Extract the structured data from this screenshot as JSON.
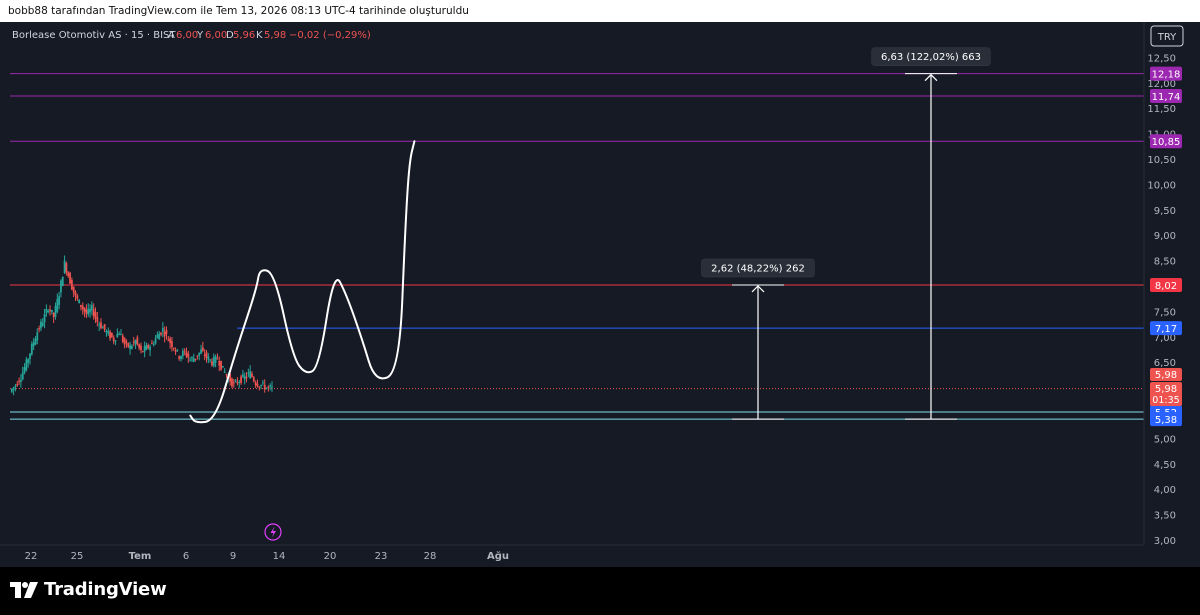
{
  "header": {
    "caption": "bobb88 tarafından TradingView.com ile Tem 13, 2026 08:13 UTC-4 tarihinde oluşturuldu"
  },
  "symbol": {
    "name": "Borlease Otomotiv AS · 15 · BIST",
    "o_label": "A",
    "o_value": "6,00",
    "h_label": "Y",
    "h_value": "6,00",
    "l_label": "D",
    "l_value": "5,96",
    "c_label": "K",
    "c_value": "5,98",
    "change": "−0,02 (−0,29%)"
  },
  "currency_badge": "TRY",
  "footer": {
    "brand": "TradingView"
  },
  "colors": {
    "bg": "#161a25",
    "up": "#26a69a",
    "down": "#ef5350",
    "purple": "#9c27b0",
    "red_line": "#f23645",
    "blue_line": "#2962ff",
    "cyan_line": "#80deea",
    "text": "#d1d4dc"
  },
  "chart_data": {
    "type": "line",
    "price_scale": {
      "ylim": [
        3.0,
        12.5
      ],
      "ticks": [
        "3,00",
        "3,50",
        "4,00",
        "4,50",
        "5,00",
        "5,50",
        "6,00",
        "6,50",
        "7,00",
        "7,50",
        "8,00",
        "8,50",
        "9,00",
        "9,50",
        "10,00",
        "10,50",
        "11,00",
        "11,50",
        "12,00",
        "12,50"
      ]
    },
    "time_scale": {
      "ticks": [
        "22",
        "25",
        "Tem",
        "6",
        "9",
        "14",
        "20",
        "23",
        "28",
        "Ağu"
      ]
    },
    "horizontal_lines": [
      {
        "price": 12.18,
        "label": "12,18",
        "color": "#9c27b0"
      },
      {
        "price": 11.74,
        "label": "11,74",
        "color": "#9c27b0"
      },
      {
        "price": 10.85,
        "label": "10,85",
        "color": "#9c27b0"
      },
      {
        "price": 8.02,
        "label": "8,02",
        "color": "#f23645"
      },
      {
        "price": 7.17,
        "label": "7,17",
        "color": "#2962ff"
      },
      {
        "price": 5.52,
        "label": "5,52",
        "color": "#2962ff"
      },
      {
        "price": 5.38,
        "label": "5,38",
        "color": "#2962ff"
      }
    ],
    "current_price": {
      "price": 5.98,
      "label": "5,98",
      "countdown": "01:35",
      "bar_label": "5,98"
    },
    "measures": [
      {
        "from": 5.38,
        "to": 8.02,
        "label": "2,62 (48,22%) 262"
      },
      {
        "from": 5.38,
        "to": 12.18,
        "label": "6,63 (122,02%) 663"
      }
    ],
    "price_series": [
      5.92,
      6.05,
      6.22,
      6.48,
      6.8,
      7.1,
      7.32,
      7.58,
      7.4,
      7.85,
      8.45,
      8.1,
      7.78,
      7.62,
      7.45,
      7.55,
      7.3,
      7.18,
      7.05,
      6.95,
      7.1,
      6.85,
      6.8,
      6.92,
      6.7,
      6.78,
      6.85,
      7.02,
      7.15,
      6.95,
      6.8,
      6.62,
      6.7,
      6.55,
      6.6,
      6.72,
      6.6,
      6.5,
      6.58,
      6.35,
      6.2,
      6.05,
      6.15,
      6.2,
      6.28,
      6.1,
      6.05,
      6.0,
      5.98
    ],
    "projection_path": [
      [
        16.0,
        5.45
      ],
      [
        16.5,
        5.3
      ],
      [
        18.5,
        5.35
      ],
      [
        20.5,
        6.7
      ],
      [
        22.6,
        7.95
      ],
      [
        22.9,
        8.35
      ],
      [
        24.4,
        8.25
      ],
      [
        26.2,
        6.6
      ],
      [
        27.5,
        6.25
      ],
      [
        28.8,
        6.4
      ],
      [
        30.3,
        8.3
      ],
      [
        31.5,
        7.85
      ],
      [
        33.1,
        6.95
      ],
      [
        34.4,
        6.1
      ],
      [
        36.8,
        6.3
      ],
      [
        37.4,
        9.2
      ],
      [
        37.8,
        10.45
      ],
      [
        38.3,
        10.85
      ]
    ]
  }
}
